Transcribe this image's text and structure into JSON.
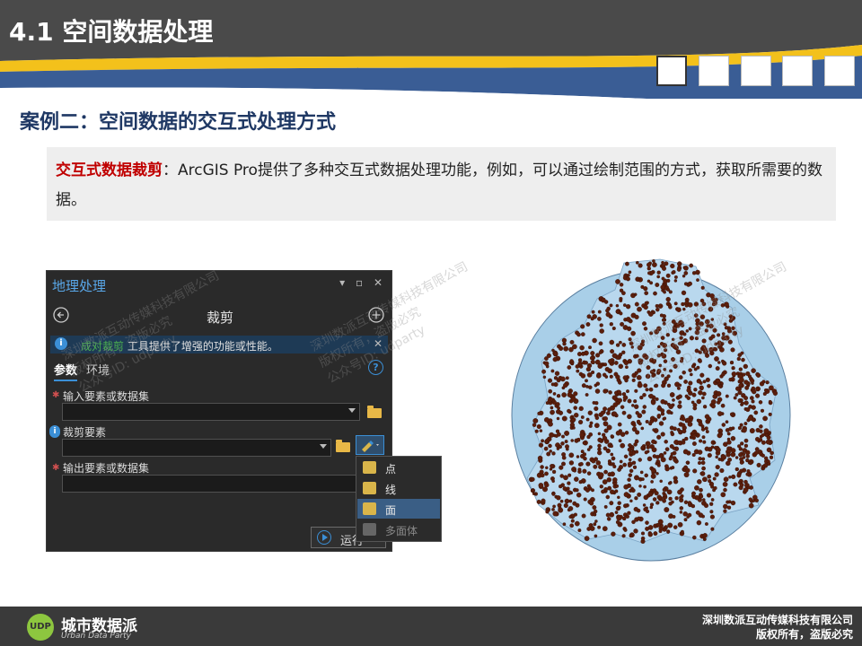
{
  "header": {
    "title": "4.1 空间数据处理"
  },
  "case_title": "案例二：空间数据的交互式处理方式",
  "description": {
    "key": "交互式数据裁剪",
    "text": "：ArcGIS Pro提供了多种交互式数据处理功能，例如，可以通过绘制范围的方式，获取所需要的数据。"
  },
  "panel": {
    "title": "地理处理",
    "tool_name": "裁剪",
    "info_link": "成对裁剪",
    "info_text": "工具提供了增强的功能或性能。",
    "tabs": [
      "参数",
      "环境"
    ],
    "fields": [
      {
        "label": "输入要素或数据集"
      },
      {
        "label": "裁剪要素"
      },
      {
        "label": "输出要素或数据集"
      }
    ],
    "run_label": "运行"
  },
  "menu": {
    "items": [
      {
        "label": "点",
        "state": "normal"
      },
      {
        "label": "线",
        "state": "normal"
      },
      {
        "label": "面",
        "state": "selected"
      },
      {
        "label": "多面体",
        "state": "disabled"
      }
    ]
  },
  "watermark": {
    "line1": "深圳数派互动传媒科技有限公司",
    "line2": "版权所有，盗版必究",
    "line3": "公众号ID: udparty"
  },
  "footer": {
    "logo_text": "城市数据派",
    "logo_sub": "Urban Data Party",
    "company": "深圳数派互动传媒科技有限公司",
    "copyright": "版权所有，盗版必究"
  },
  "colors": {
    "accent": "#3b8fd6",
    "title_red": "#c00000",
    "case_blue": "#1f3864",
    "map_fill": "#a9cfe8",
    "point_color": "#5a1e0c",
    "menu_selected": "#3a5e85"
  }
}
